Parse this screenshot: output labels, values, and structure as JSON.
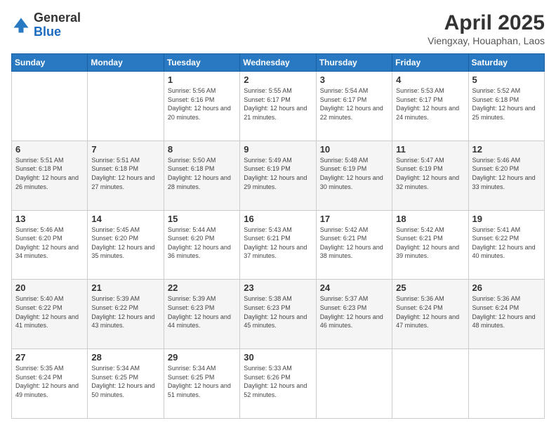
{
  "logo": {
    "general": "General",
    "blue": "Blue"
  },
  "header": {
    "title": "April 2025",
    "subtitle": "Viengxay, Houaphan, Laos"
  },
  "weekdays": [
    "Sunday",
    "Monday",
    "Tuesday",
    "Wednesday",
    "Thursday",
    "Friday",
    "Saturday"
  ],
  "weeks": [
    [
      {
        "day": "",
        "sunrise": "",
        "sunset": "",
        "daylight": ""
      },
      {
        "day": "",
        "sunrise": "",
        "sunset": "",
        "daylight": ""
      },
      {
        "day": "1",
        "sunrise": "Sunrise: 5:56 AM",
        "sunset": "Sunset: 6:16 PM",
        "daylight": "Daylight: 12 hours and 20 minutes."
      },
      {
        "day": "2",
        "sunrise": "Sunrise: 5:55 AM",
        "sunset": "Sunset: 6:17 PM",
        "daylight": "Daylight: 12 hours and 21 minutes."
      },
      {
        "day": "3",
        "sunrise": "Sunrise: 5:54 AM",
        "sunset": "Sunset: 6:17 PM",
        "daylight": "Daylight: 12 hours and 22 minutes."
      },
      {
        "day": "4",
        "sunrise": "Sunrise: 5:53 AM",
        "sunset": "Sunset: 6:17 PM",
        "daylight": "Daylight: 12 hours and 24 minutes."
      },
      {
        "day": "5",
        "sunrise": "Sunrise: 5:52 AM",
        "sunset": "Sunset: 6:18 PM",
        "daylight": "Daylight: 12 hours and 25 minutes."
      }
    ],
    [
      {
        "day": "6",
        "sunrise": "Sunrise: 5:51 AM",
        "sunset": "Sunset: 6:18 PM",
        "daylight": "Daylight: 12 hours and 26 minutes."
      },
      {
        "day": "7",
        "sunrise": "Sunrise: 5:51 AM",
        "sunset": "Sunset: 6:18 PM",
        "daylight": "Daylight: 12 hours and 27 minutes."
      },
      {
        "day": "8",
        "sunrise": "Sunrise: 5:50 AM",
        "sunset": "Sunset: 6:18 PM",
        "daylight": "Daylight: 12 hours and 28 minutes."
      },
      {
        "day": "9",
        "sunrise": "Sunrise: 5:49 AM",
        "sunset": "Sunset: 6:19 PM",
        "daylight": "Daylight: 12 hours and 29 minutes."
      },
      {
        "day": "10",
        "sunrise": "Sunrise: 5:48 AM",
        "sunset": "Sunset: 6:19 PM",
        "daylight": "Daylight: 12 hours and 30 minutes."
      },
      {
        "day": "11",
        "sunrise": "Sunrise: 5:47 AM",
        "sunset": "Sunset: 6:19 PM",
        "daylight": "Daylight: 12 hours and 32 minutes."
      },
      {
        "day": "12",
        "sunrise": "Sunrise: 5:46 AM",
        "sunset": "Sunset: 6:20 PM",
        "daylight": "Daylight: 12 hours and 33 minutes."
      }
    ],
    [
      {
        "day": "13",
        "sunrise": "Sunrise: 5:46 AM",
        "sunset": "Sunset: 6:20 PM",
        "daylight": "Daylight: 12 hours and 34 minutes."
      },
      {
        "day": "14",
        "sunrise": "Sunrise: 5:45 AM",
        "sunset": "Sunset: 6:20 PM",
        "daylight": "Daylight: 12 hours and 35 minutes."
      },
      {
        "day": "15",
        "sunrise": "Sunrise: 5:44 AM",
        "sunset": "Sunset: 6:20 PM",
        "daylight": "Daylight: 12 hours and 36 minutes."
      },
      {
        "day": "16",
        "sunrise": "Sunrise: 5:43 AM",
        "sunset": "Sunset: 6:21 PM",
        "daylight": "Daylight: 12 hours and 37 minutes."
      },
      {
        "day": "17",
        "sunrise": "Sunrise: 5:42 AM",
        "sunset": "Sunset: 6:21 PM",
        "daylight": "Daylight: 12 hours and 38 minutes."
      },
      {
        "day": "18",
        "sunrise": "Sunrise: 5:42 AM",
        "sunset": "Sunset: 6:21 PM",
        "daylight": "Daylight: 12 hours and 39 minutes."
      },
      {
        "day": "19",
        "sunrise": "Sunrise: 5:41 AM",
        "sunset": "Sunset: 6:22 PM",
        "daylight": "Daylight: 12 hours and 40 minutes."
      }
    ],
    [
      {
        "day": "20",
        "sunrise": "Sunrise: 5:40 AM",
        "sunset": "Sunset: 6:22 PM",
        "daylight": "Daylight: 12 hours and 41 minutes."
      },
      {
        "day": "21",
        "sunrise": "Sunrise: 5:39 AM",
        "sunset": "Sunset: 6:22 PM",
        "daylight": "Daylight: 12 hours and 43 minutes."
      },
      {
        "day": "22",
        "sunrise": "Sunrise: 5:39 AM",
        "sunset": "Sunset: 6:23 PM",
        "daylight": "Daylight: 12 hours and 44 minutes."
      },
      {
        "day": "23",
        "sunrise": "Sunrise: 5:38 AM",
        "sunset": "Sunset: 6:23 PM",
        "daylight": "Daylight: 12 hours and 45 minutes."
      },
      {
        "day": "24",
        "sunrise": "Sunrise: 5:37 AM",
        "sunset": "Sunset: 6:23 PM",
        "daylight": "Daylight: 12 hours and 46 minutes."
      },
      {
        "day": "25",
        "sunrise": "Sunrise: 5:36 AM",
        "sunset": "Sunset: 6:24 PM",
        "daylight": "Daylight: 12 hours and 47 minutes."
      },
      {
        "day": "26",
        "sunrise": "Sunrise: 5:36 AM",
        "sunset": "Sunset: 6:24 PM",
        "daylight": "Daylight: 12 hours and 48 minutes."
      }
    ],
    [
      {
        "day": "27",
        "sunrise": "Sunrise: 5:35 AM",
        "sunset": "Sunset: 6:24 PM",
        "daylight": "Daylight: 12 hours and 49 minutes."
      },
      {
        "day": "28",
        "sunrise": "Sunrise: 5:34 AM",
        "sunset": "Sunset: 6:25 PM",
        "daylight": "Daylight: 12 hours and 50 minutes."
      },
      {
        "day": "29",
        "sunrise": "Sunrise: 5:34 AM",
        "sunset": "Sunset: 6:25 PM",
        "daylight": "Daylight: 12 hours and 51 minutes."
      },
      {
        "day": "30",
        "sunrise": "Sunrise: 5:33 AM",
        "sunset": "Sunset: 6:26 PM",
        "daylight": "Daylight: 12 hours and 52 minutes."
      },
      {
        "day": "",
        "sunrise": "",
        "sunset": "",
        "daylight": ""
      },
      {
        "day": "",
        "sunrise": "",
        "sunset": "",
        "daylight": ""
      },
      {
        "day": "",
        "sunrise": "",
        "sunset": "",
        "daylight": ""
      }
    ]
  ]
}
